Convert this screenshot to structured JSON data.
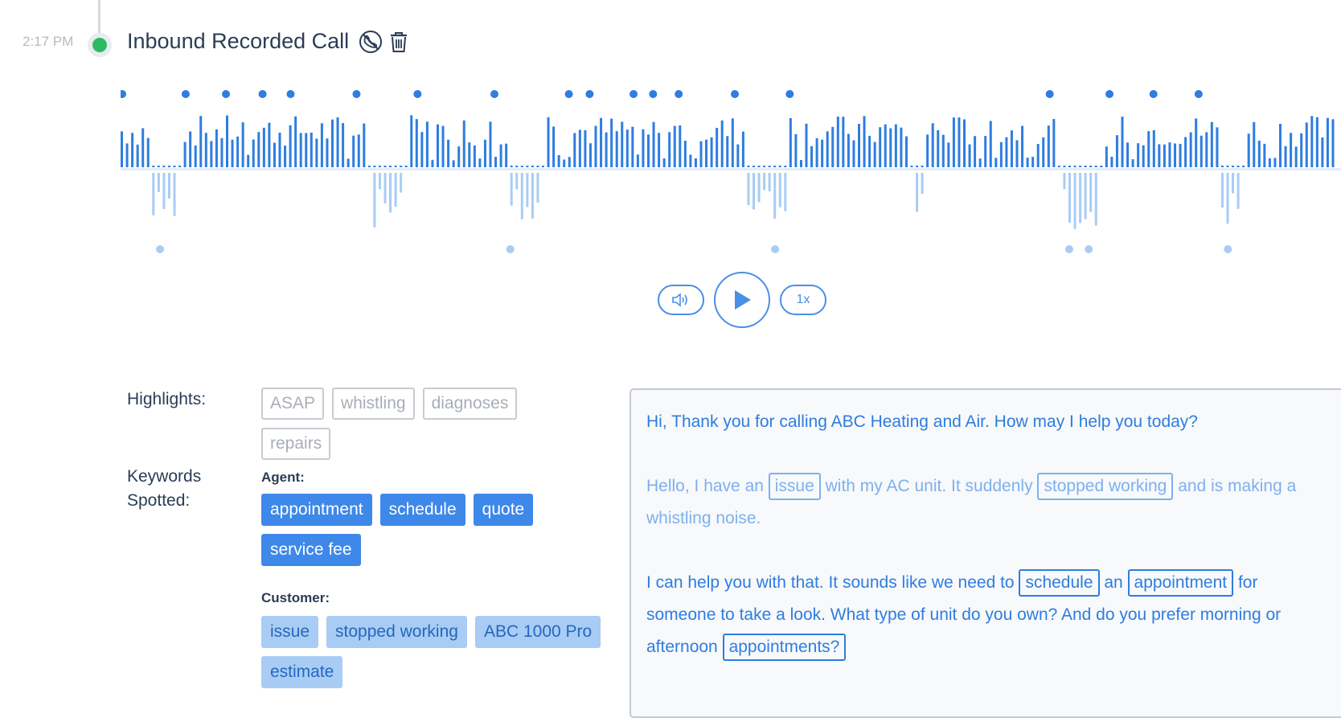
{
  "event": {
    "timestamp": "2:17 PM",
    "title": "Inbound Recorded Call",
    "status_color": "#2dba63",
    "icons": [
      "recording-phone-icon",
      "trash-icon"
    ]
  },
  "waveform": {
    "agent_color": "#2e7de0",
    "customer_color": "#a9ccf4",
    "agent_keyword_markers": [
      0.0,
      0.052,
      0.085,
      0.115,
      0.138,
      0.192,
      0.242,
      0.305,
      0.366,
      0.383,
      0.419,
      0.435,
      0.456,
      0.502,
      0.547,
      0.76,
      0.809,
      0.845,
      0.882
    ],
    "customer_keyword_markers": [
      0.031,
      0.318,
      0.535,
      0.776,
      0.792,
      0.906
    ]
  },
  "player": {
    "volume_icon": "volume-icon",
    "play_icon": "play-icon",
    "speed_label": "1x"
  },
  "highlights": {
    "label": "Highlights:",
    "tags": [
      "ASAP",
      "whistling",
      "diagnoses",
      "repairs"
    ]
  },
  "keywords": {
    "label_line1": "Keywords",
    "label_line2": "Spotted:",
    "agent_label": "Agent:",
    "agent_tags": [
      "appointment",
      "schedule",
      "quote",
      "service fee"
    ],
    "customer_label": "Customer:",
    "customer_tags": [
      "issue",
      "stopped working",
      "ABC 1000 Pro",
      "estimate"
    ]
  },
  "transcript": {
    "utterances": [
      {
        "speaker": "agent",
        "parts": [
          {
            "t": "Hi, Thank you for calling ABC Heating and Air. How may I help you today?"
          }
        ]
      },
      {
        "speaker": "customer",
        "parts": [
          {
            "t": "Hello, I have an "
          },
          {
            "k": "issue"
          },
          {
            "t": " with my AC unit. It suddenly "
          },
          {
            "k": "stopped working"
          },
          {
            "t": " and is making a"
          },
          {
            "br": true
          },
          {
            "t": "whistling noise."
          }
        ]
      },
      {
        "speaker": "agent",
        "parts": [
          {
            "t": "I can help you with that. It sounds like we need to "
          },
          {
            "k": "schedule"
          },
          {
            "t": " an "
          },
          {
            "k": "appointment"
          },
          {
            "t": " for"
          },
          {
            "br": true
          },
          {
            "t": "someone to take a look. What type of unit do you own? And do you prefer morning or"
          },
          {
            "br": true
          },
          {
            "t": "afternoon "
          },
          {
            "k": "appointments?"
          }
        ]
      }
    ]
  }
}
